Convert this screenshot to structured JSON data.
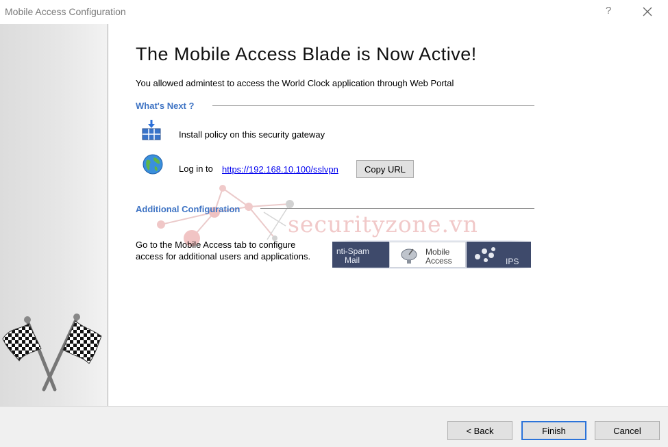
{
  "window": {
    "title": "Mobile Access Configuration",
    "help_label": "?"
  },
  "main": {
    "heading": "The Mobile Access Blade is Now Active!",
    "subtext": "You allowed admintest to access the World Clock application through Web Portal",
    "whats_next": {
      "title": "What's Next ?",
      "install_text": "Install policy on this security gateway",
      "login_prefix": "Log in to",
      "login_url": "https://192.168.10.100/sslvpn",
      "copy_url_label": "Copy URL"
    },
    "additional": {
      "title": "Additional Configuration",
      "line1": "Go to the Mobile Access tab to configure",
      "line2": "access for additional users and applications."
    },
    "tabs_image": {
      "left_tab_line1": "nti-Spam",
      "left_tab_line2": "Mail",
      "active_tab_line1": "Mobile",
      "active_tab_line2": "Access",
      "right_tab": "IPS"
    },
    "watermark": "securityzone.vn"
  },
  "footer": {
    "back_label": "< Back",
    "finish_label": "Finish",
    "cancel_label": "Cancel"
  },
  "colors": {
    "section_title": "#3f74c4",
    "link": "#0000ee",
    "primary_border": "#2b73d9"
  }
}
